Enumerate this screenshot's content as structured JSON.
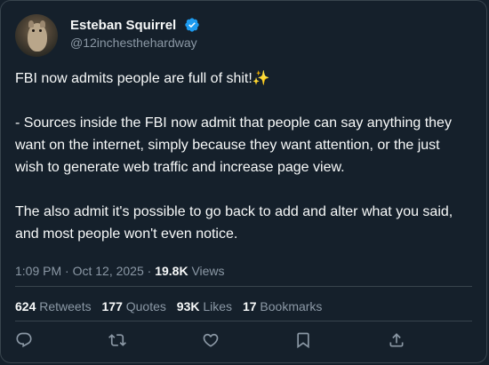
{
  "author": {
    "display_name": "Esteban Squirrel",
    "handle": "@12inchesthehardway",
    "verified": true,
    "verified_icon": "verified-badge-icon",
    "avatar_icon": "squirrel-avatar"
  },
  "tweet": {
    "line1": "FBI now admits people are full of shit!",
    "line1_emoji": "✨",
    "paragraph2": "- Sources inside the FBI now admit that people can say anything they want on the internet, simply because they want attention, or the just wish to generate web traffic and increase page view.",
    "paragraph3": "The also admit it's possible to go back to add and alter what you said, and most people won't even notice."
  },
  "meta": {
    "timestamp": "1:09 PM · Oct 12, 2025",
    "separator": "·",
    "views_count": "19.8K",
    "views_label": "Views"
  },
  "stats": {
    "retweets_count": "624",
    "retweets_label": "Retweets",
    "quotes_count": "177",
    "quotes_label": "Quotes",
    "likes_count": "93K",
    "likes_label": "Likes",
    "bookmarks_count": "17",
    "bookmarks_label": "Bookmarks"
  },
  "actions": [
    "reply-icon",
    "retweet-icon",
    "like-icon",
    "bookmark-icon",
    "share-icon"
  ],
  "colors": {
    "background": "#15202b",
    "border": "#38444d",
    "text_primary": "#f7f9f9",
    "text_secondary": "#8b98a5",
    "verified_blue": "#1d9bf0"
  }
}
